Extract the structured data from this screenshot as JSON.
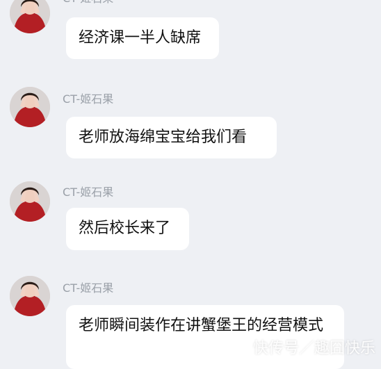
{
  "messages": [
    {
      "sender": "CT-姬石果",
      "text": "经济课一半人缺席"
    },
    {
      "sender": "CT-姬石果",
      "text": "老师放海绵宝宝给我们看"
    },
    {
      "sender": "CT-姬石果",
      "text": "然后校长来了"
    },
    {
      "sender": "CT-姬石果",
      "text": "老师瞬间装作在讲蟹堡王的经营模式"
    }
  ],
  "watermark": "快传号／趣囧快乐",
  "colors": {
    "background": "#eef0f4",
    "bubble": "#ffffff",
    "sender": "#9aa0a8",
    "text": "#111111"
  }
}
